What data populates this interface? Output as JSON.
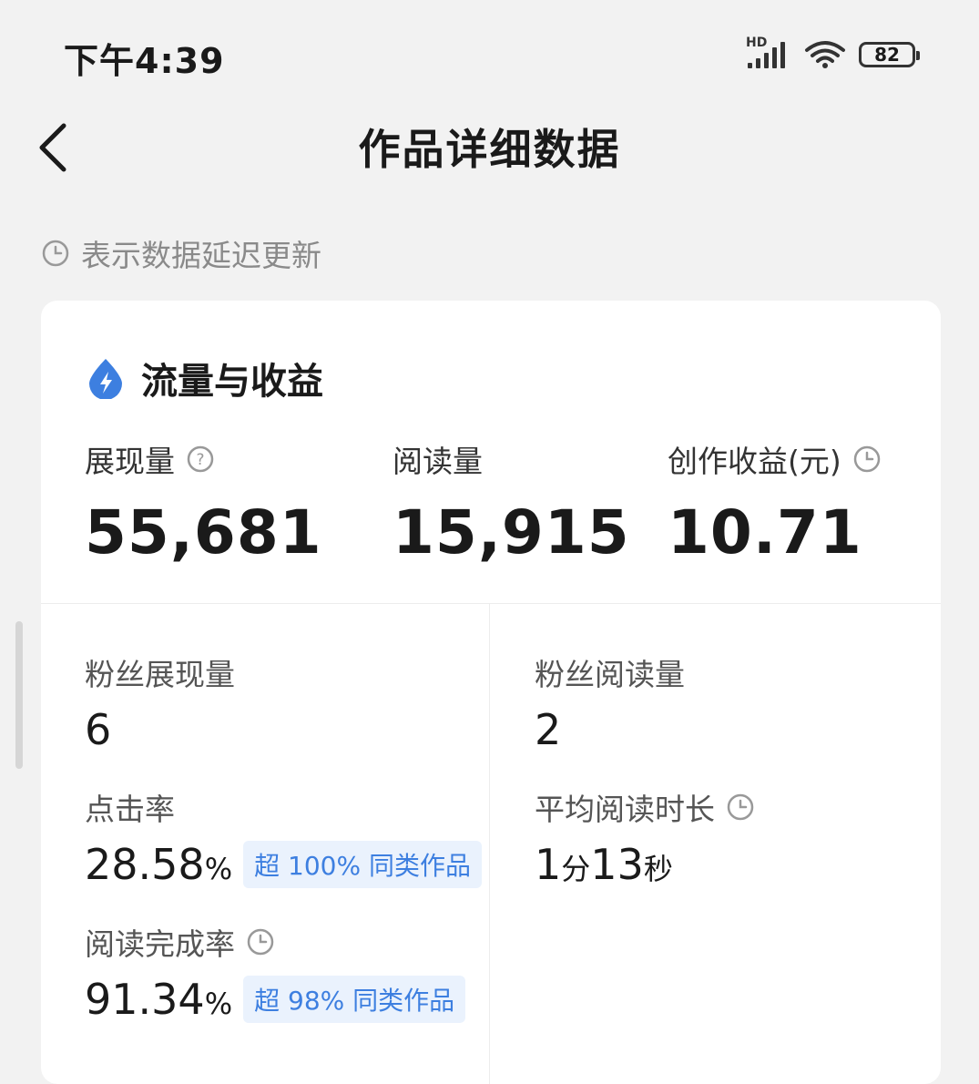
{
  "status_bar": {
    "time": "下午4:39",
    "network": "HD",
    "battery": "82"
  },
  "header": {
    "title": "作品详细数据"
  },
  "notice": {
    "text": "表示数据延迟更新"
  },
  "card": {
    "title": "流量与收益",
    "metrics": [
      {
        "label": "展现量",
        "value": "55,681"
      },
      {
        "label": "阅读量",
        "value": "15,915"
      },
      {
        "label": "创作收益(元)",
        "value": "10.71"
      }
    ],
    "fan_impressions": {
      "label": "粉丝展现量",
      "value": "6"
    },
    "fan_reads": {
      "label": "粉丝阅读量",
      "value": "2"
    },
    "click_rate": {
      "label": "点击率",
      "value": "28.58",
      "unit": "%",
      "badge": "超 100% 同类作品"
    },
    "avg_read_time": {
      "label": "平均阅读时长",
      "minutes": "1",
      "min_unit": "分",
      "seconds": "13",
      "sec_unit": "秒"
    },
    "completion_rate": {
      "label": "阅读完成率",
      "value": "91.34",
      "unit": "%",
      "badge": "超 98% 同类作品"
    }
  },
  "colors": {
    "accent": "#3d7fe0",
    "badge_bg": "#eaf2fd",
    "background": "#f2f2f2"
  },
  "icons": {
    "back": "chevron-left-icon",
    "clock": "clock-icon",
    "help": "question-icon",
    "section": "drop-lightning-icon"
  }
}
